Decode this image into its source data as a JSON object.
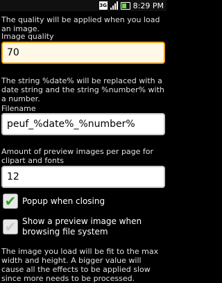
{
  "statusbar": {
    "network_label": "3G",
    "time": "8:29 PM"
  },
  "settings": {
    "intro_text": "The quality will be applied when you load an image.",
    "image_quality_label": "Image quality",
    "image_quality_value": "70",
    "date_hint": "The string %date% will be replaced with a date string and the string %number% with a number.",
    "filename_label": "Filename",
    "filename_value": "peuf_%date%_%number%",
    "preview_count_label": "Amount of preview images per page for clipart and fonts",
    "preview_count_value": "12",
    "popup_label": "Popup when closing",
    "popup_checked": true,
    "preview_browse_label": "Show a preview image when browsing file system",
    "preview_browse_checked": false,
    "fit_hint": "The image you load will be fit to the max width and height. A bigger value will cause all the effects to be applied slow since more needs to be processed."
  },
  "colors": {
    "checked": "#2aa12a",
    "focus_border": "#f0a020"
  }
}
